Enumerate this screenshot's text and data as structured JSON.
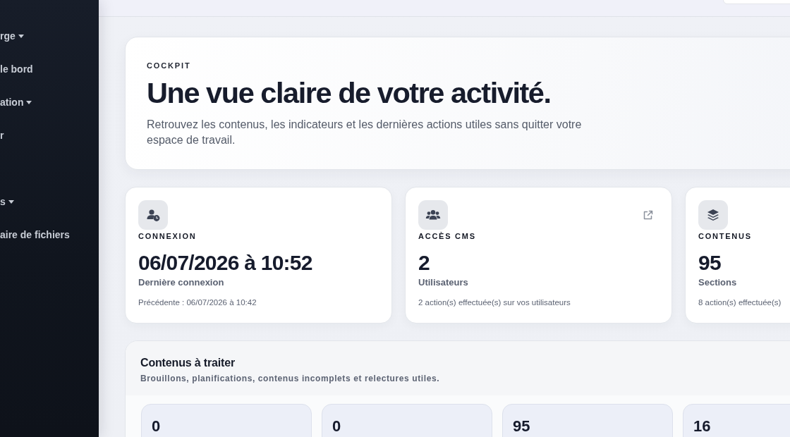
{
  "sidebar": {
    "groups": [
      {
        "items": [
          {
            "label": "rge",
            "has_submenu": true
          },
          {
            "label": "le bord",
            "has_submenu": false
          },
          {
            "label": "ation",
            "has_submenu": true
          },
          {
            "label": "r",
            "has_submenu": false
          }
        ]
      },
      {
        "items": [
          {
            "label": "s",
            "has_submenu": true
          },
          {
            "label": "aire de fichiers",
            "has_submenu": false
          }
        ]
      }
    ]
  },
  "hero": {
    "eyebrow": "COCKPIT",
    "title": "Une vue claire de votre activité.",
    "text": "Retrouvez les contenus, les indicateurs et les dernières actions utiles sans quitter votre espace de travail."
  },
  "stats": [
    {
      "kind": "connexion",
      "label": "CONNEXION",
      "value": "06/07/2026 à 10:52",
      "caption": "Dernière connexion",
      "note": "Précédente : 06/07/2026 à 10:42",
      "has_link": false
    },
    {
      "kind": "users",
      "label": "ACCÈS CMS",
      "value": "2",
      "caption": "Utilisateurs",
      "note": "2 action(s) effectuée(s) sur vos utilisateurs",
      "has_link": true
    },
    {
      "kind": "contents",
      "label": "CONTENUS",
      "value": "95",
      "caption": "Sections",
      "note": "8 action(s) effectuée(s)",
      "has_link": false
    }
  ],
  "queue": {
    "title": "Contenus à traiter",
    "subtitle": "Brouillons, planifications, contenus incomplets et relectures utiles.",
    "counts": [
      "0",
      "0",
      "95",
      "16"
    ]
  }
}
